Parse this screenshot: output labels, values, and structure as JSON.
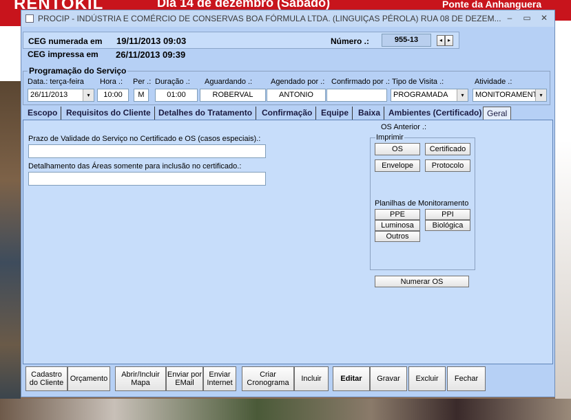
{
  "background": {
    "banner_left": "RENTOKIL",
    "banner_mid": "Dia 14 de dezembro (Sábado)",
    "banner_right": "Ponte da Anhanguera"
  },
  "window": {
    "title": "PROCIP - INDÚSTRIA E COMÉRCIO DE CONSERVAS BOA FÓRMULA LTDA.  (LINGUIÇAS PÉROLA)  RUA 08 DE DEZEM...",
    "minimize": "–",
    "maximize": "▭",
    "close": "✕"
  },
  "header": {
    "ceg_numerada_label": "CEG numerada em",
    "ceg_numerada_value": "19/11/2013 09:03",
    "ceg_impressa_label": "CEG impressa em",
    "ceg_impressa_value": "26/11/2013 09:39",
    "numero_label": "Número .:",
    "numero_value": "955-13",
    "nav_prev": "◂",
    "nav_next": "▸"
  },
  "programacao": {
    "title": "Programação do Serviço",
    "data_label": "Data.: terça-feira",
    "data_value": "26/11/2013",
    "hora_label": "Hora .:",
    "hora_value": "10:00",
    "per_label": "Per .:",
    "per_value": "M",
    "duracao_label": "Duração .:",
    "duracao_value": "01:00",
    "aguardando_label": "Aguardando .:",
    "aguardando_value": "ROBERVAL",
    "agendado_label": "Agendado por .:",
    "agendado_value": "ANTONIO",
    "confirmado_label": "Confirmado por .:",
    "confirmado_value": "",
    "tipo_label": "Tipo de Visita .:",
    "tipo_value": "PROGRAMADA",
    "atividade_label": "Atividade .:",
    "atividade_value": "MONITORAMENT"
  },
  "tabs": [
    "Escopo",
    "Requisitos do Cliente",
    "Detalhes do Tratamento",
    "Confirmação",
    "Equipe",
    "Baixa",
    "Ambientes (Certificado)",
    "Geral"
  ],
  "geral": {
    "prazo_label": "Prazo de Validade do Serviço no Certificado e OS (casos especiais).:",
    "prazo_value": "",
    "detalhamento_label": "Detalhamento das Áreas somente para inclusão no certificado.:",
    "detalhamento_value": "",
    "os_anterior_label": "OS Anterior .:",
    "imprimir_label": "Imprimir",
    "btn_os": "OS",
    "btn_certificado": "Certificado",
    "btn_envelope": "Envelope",
    "btn_protocolo": "Protocolo",
    "planilhas_label": "Planilhas de Monitoramento",
    "btn_ppe": "PPE",
    "btn_ppi": "PPI",
    "btn_luminosa": "Luminosa",
    "btn_biologica": "Biológica",
    "btn_outros": "Outros",
    "btn_numerar_os": "Numerar OS"
  },
  "bottom": {
    "cadastro": "Cadastro do Cliente",
    "orcamento": "Orçamento",
    "abrir_mapa": "Abrir/Incluir Mapa",
    "enviar_email": "Enviar por EMail",
    "enviar_internet": "Enviar Internet",
    "criar_cronograma": "Criar Cronograma",
    "incluir": "Incluir",
    "editar": "Editar",
    "gravar": "Gravar",
    "excluir": "Excluir",
    "fechar": "Fechar"
  }
}
